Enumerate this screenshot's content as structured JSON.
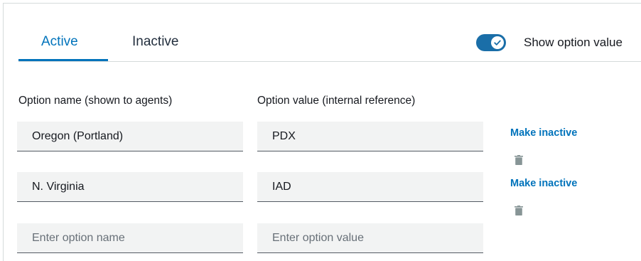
{
  "tabs": [
    {
      "label": "Active",
      "selected": true
    },
    {
      "label": "Inactive",
      "selected": false
    }
  ],
  "toggle": {
    "label": "Show option value",
    "on": true
  },
  "columns": {
    "name_header": "Option name (shown to agents)",
    "value_header": "Option value (internal reference)"
  },
  "options": [
    {
      "name": "Oregon (Portland)",
      "value": "PDX",
      "action": "Make inactive",
      "delete_icon": "trash-icon"
    },
    {
      "name": "N. Virginia",
      "value": "IAD",
      "action": "Make inactive",
      "delete_icon": "trash-icon"
    }
  ],
  "new_option": {
    "name_placeholder": "Enter option name",
    "value_placeholder": "Enter option value"
  },
  "colors": {
    "accent": "#0073bb",
    "toggle_bg": "#1a6ea8",
    "field_bg": "#f2f3f3"
  }
}
